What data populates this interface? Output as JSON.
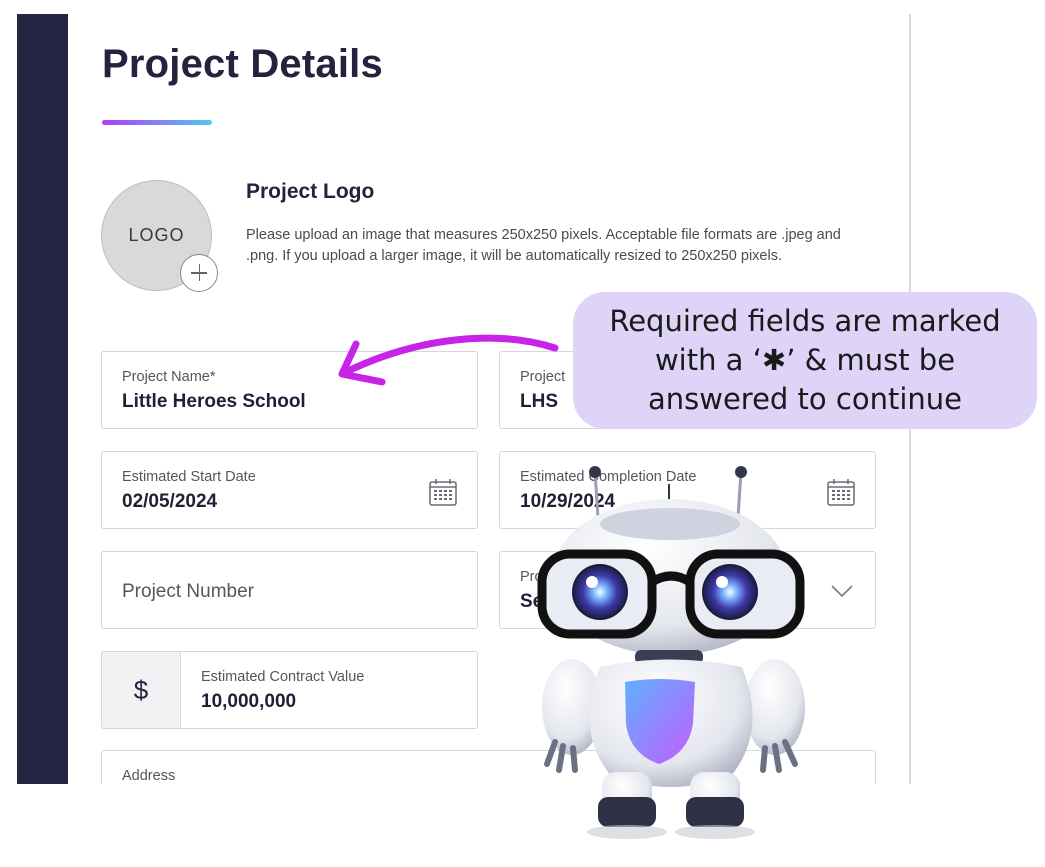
{
  "page": {
    "title": "Project Details"
  },
  "logo": {
    "placeholder_text": "LOGO",
    "heading": "Project Logo",
    "description": "Please upload an image that measures 250x250 pixels. Acceptable file formats are .jpeg and .png. If you upload a larger image, it will be automatically resized to 250x250 pixels."
  },
  "fields": {
    "project_name": {
      "label": "Project Name*",
      "value": "Little Heroes School"
    },
    "project_abbrev": {
      "label": "Project",
      "value": "LHS"
    },
    "start_date": {
      "label": "Estimated Start Date",
      "value": "02/05/2024",
      "icon": "calendar-icon"
    },
    "completion_date": {
      "label": "Estimated Completion Date",
      "value": "10/29/2024",
      "icon": "calendar-icon"
    },
    "project_number": {
      "placeholder": "Project Number"
    },
    "project_select": {
      "label": "Pro",
      "value": "Se",
      "icon": "chevron-down-icon"
    },
    "contract_value": {
      "prefix": "$",
      "label": "Estimated Contract Value",
      "value": "10,000,000"
    },
    "address": {
      "label": "Address"
    }
  },
  "callout": {
    "line1": "Required fields are marked",
    "line2": "with a ‘✱’ & must be",
    "line3": "answered to continue"
  },
  "colors": {
    "sidebar": "#242443",
    "title": "#23223f",
    "underline_start": "#b13cf5",
    "underline_end": "#52c6f4",
    "callout_bg": "#ddd4f8",
    "arrow": "#c624e6"
  }
}
